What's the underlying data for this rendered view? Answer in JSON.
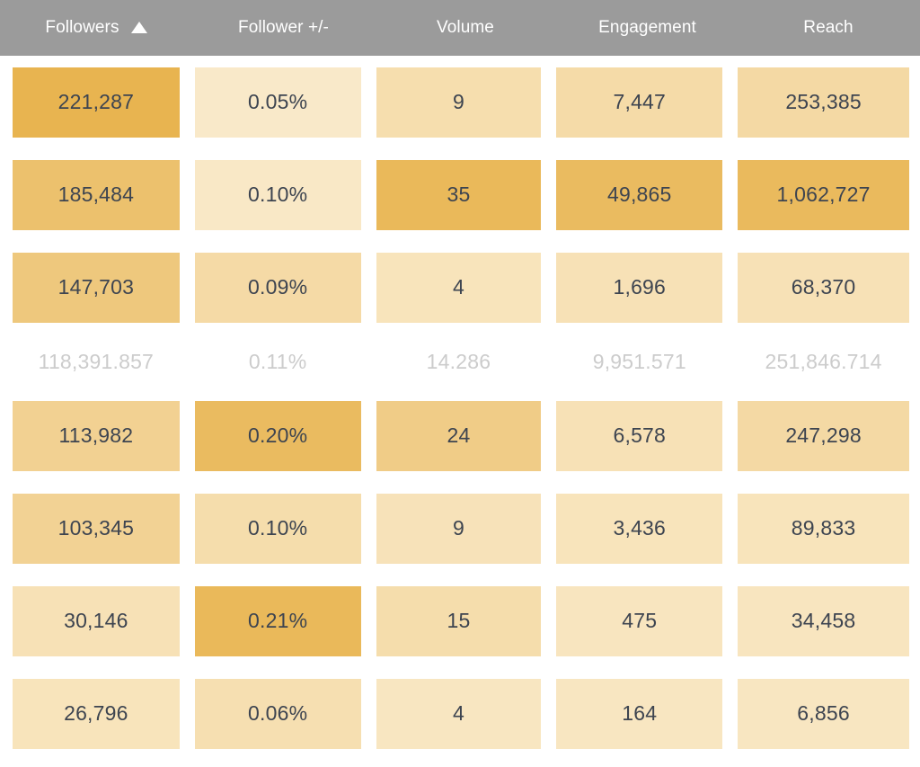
{
  "table": {
    "columns": [
      {
        "key": "followers",
        "label": "Followers",
        "sorted": true,
        "sort_icon": "sort-ascending-triangle-icon",
        "sort_direction": "asc"
      },
      {
        "key": "follower_pm",
        "label": "Follower +/-",
        "sorted": false,
        "sort_icon": null,
        "sort_direction": null
      },
      {
        "key": "volume",
        "label": "Volume",
        "sorted": false,
        "sort_icon": null,
        "sort_direction": null
      },
      {
        "key": "engagement",
        "label": "Engagement",
        "sorted": false,
        "sort_icon": null,
        "sort_direction": null
      },
      {
        "key": "reach",
        "label": "Reach",
        "sorted": false,
        "sort_icon": null,
        "sort_direction": null
      },
      {
        "key": "partial",
        "label": "",
        "sorted": false,
        "sort_icon": null,
        "sort_direction": null
      }
    ],
    "rows": [
      {
        "type": "data",
        "cells": [
          {
            "value": "221,287",
            "intensity": 1.0
          },
          {
            "value": "0.05%",
            "intensity": 0.08
          },
          {
            "value": "9",
            "intensity": 0.28
          },
          {
            "value": "7,447",
            "intensity": 0.33
          },
          {
            "value": "253,385",
            "intensity": 0.36
          },
          {
            "value": "",
            "intensity": 0.33
          }
        ]
      },
      {
        "type": "data",
        "cells": [
          {
            "value": "185,484",
            "intensity": 0.78
          },
          {
            "value": "0.10%",
            "intensity": 0.1
          },
          {
            "value": "35",
            "intensity": 0.92
          },
          {
            "value": "49,865",
            "intensity": 0.88
          },
          {
            "value": "1,062,727",
            "intensity": 0.9
          },
          {
            "value": "",
            "intensity": 0.88
          }
        ]
      },
      {
        "type": "data",
        "cells": [
          {
            "value": "147,703",
            "intensity": 0.66
          },
          {
            "value": "0.09%",
            "intensity": 0.34
          },
          {
            "value": "4",
            "intensity": 0.18
          },
          {
            "value": "1,696",
            "intensity": 0.22
          },
          {
            "value": "68,370",
            "intensity": 0.22
          },
          {
            "value": "",
            "intensity": 0.2
          }
        ]
      },
      {
        "type": "summary",
        "cells": [
          {
            "value": "118,391.857",
            "intensity": 0
          },
          {
            "value": "0.11%",
            "intensity": 0
          },
          {
            "value": "14.286",
            "intensity": 0
          },
          {
            "value": "9,951.571",
            "intensity": 0
          },
          {
            "value": "251,846.714",
            "intensity": 0
          },
          {
            "value": "",
            "intensity": 0
          }
        ]
      },
      {
        "type": "data",
        "cells": [
          {
            "value": "113,982",
            "intensity": 0.5
          },
          {
            "value": "0.20%",
            "intensity": 0.88
          },
          {
            "value": "24",
            "intensity": 0.58
          },
          {
            "value": "6,578",
            "intensity": 0.22
          },
          {
            "value": "247,298",
            "intensity": 0.36
          },
          {
            "value": "",
            "intensity": 0.3
          }
        ]
      },
      {
        "type": "data",
        "cells": [
          {
            "value": "103,345",
            "intensity": 0.48
          },
          {
            "value": "0.10%",
            "intensity": 0.3
          },
          {
            "value": "9",
            "intensity": 0.2
          },
          {
            "value": "3,436",
            "intensity": 0.18
          },
          {
            "value": "89,833",
            "intensity": 0.18
          },
          {
            "value": "",
            "intensity": 0.16
          }
        ]
      },
      {
        "type": "data",
        "cells": [
          {
            "value": "30,146",
            "intensity": 0.22
          },
          {
            "value": "0.21%",
            "intensity": 0.92
          },
          {
            "value": "15",
            "intensity": 0.3
          },
          {
            "value": "475",
            "intensity": 0.15
          },
          {
            "value": "34,458",
            "intensity": 0.15
          },
          {
            "value": "",
            "intensity": 0.14
          }
        ]
      },
      {
        "type": "data",
        "cells": [
          {
            "value": "26,796",
            "intensity": 0.18
          },
          {
            "value": "0.06%",
            "intensity": 0.26
          },
          {
            "value": "4",
            "intensity": 0.14
          },
          {
            "value": "164",
            "intensity": 0.14
          },
          {
            "value": "6,856",
            "intensity": 0.14
          },
          {
            "value": "",
            "intensity": 0.14
          }
        ]
      }
    ]
  },
  "colors": {
    "header_background": "#9b9b9b",
    "header_text": "#ffffff",
    "cell_text": "#3d4450",
    "summary_text": "#cccccc",
    "heat_low": "#fbeed3",
    "heat_high": "#e8b450",
    "page_background": "#ffffff"
  }
}
